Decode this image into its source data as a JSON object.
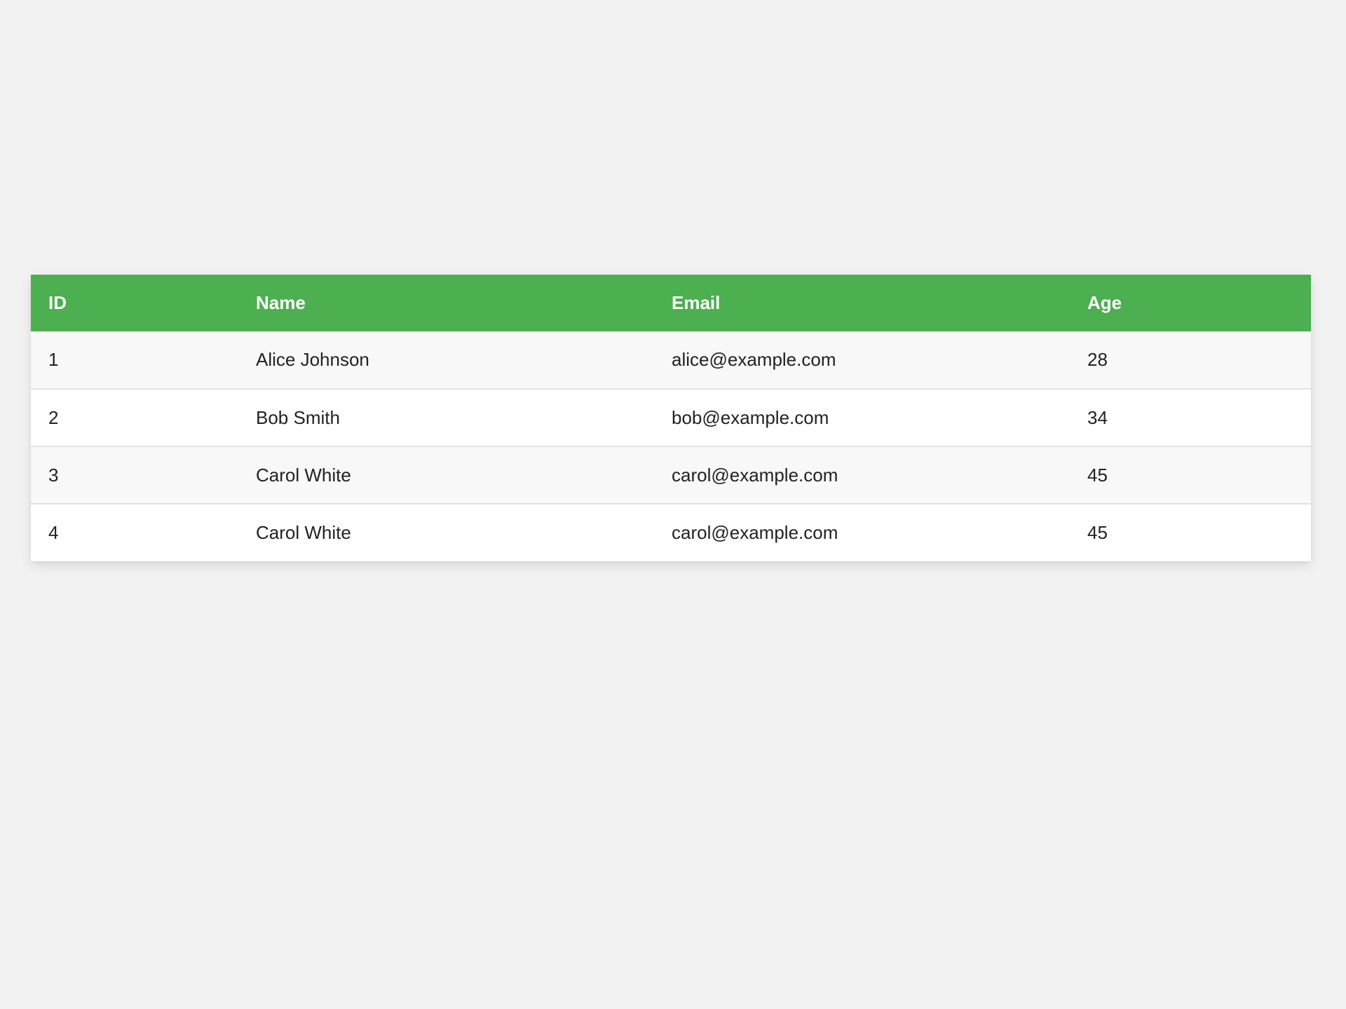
{
  "table": {
    "headers": [
      "ID",
      "Name",
      "Email",
      "Age"
    ],
    "rows": [
      [
        "1",
        "Alice Johnson",
        "alice@example.com",
        "28"
      ],
      [
        "2",
        "Bob Smith",
        "bob@example.com",
        "34"
      ],
      [
        "3",
        "Carol White",
        "carol@example.com",
        "45"
      ],
      [
        "4",
        "Carol White",
        "carol@example.com",
        "45"
      ]
    ]
  },
  "colors": {
    "header_background": "#4caf50",
    "header_text": "#ffffff",
    "page_background": "#f2f2f2",
    "row_odd": "#f8f8f8",
    "row_even": "#ffffff"
  }
}
